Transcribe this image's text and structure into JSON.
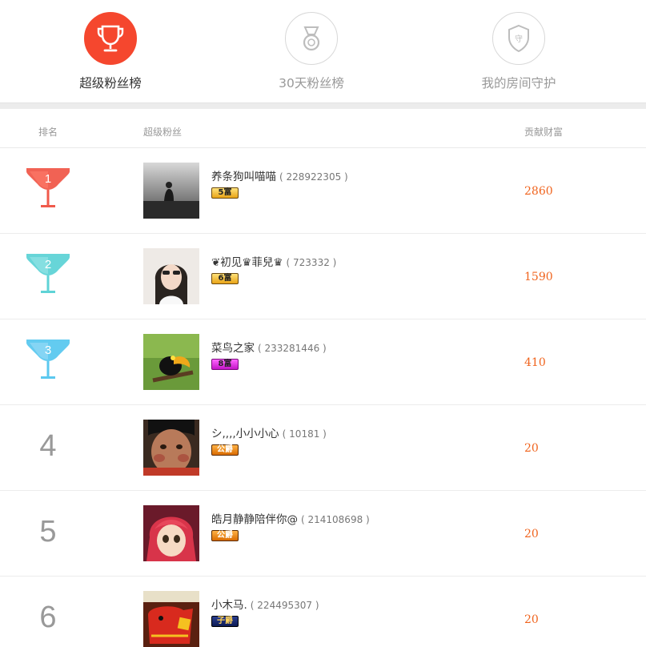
{
  "tabs": [
    {
      "label": "超级粉丝榜",
      "icon": "trophy-icon",
      "active": true
    },
    {
      "label": "30天粉丝榜",
      "icon": "medal-icon",
      "active": false
    },
    {
      "label": "我的房间守护",
      "icon": "shield-icon",
      "active": false
    }
  ],
  "shield_char": "守",
  "table": {
    "headers": {
      "rank": "排名",
      "fan": "超级粉丝",
      "wealth": "贡献财富"
    },
    "rows": [
      {
        "rank": "1",
        "name": "养条狗叫喵喵",
        "uid": "( 228922305 )",
        "badge": "5富",
        "wealth": "2860"
      },
      {
        "rank": "2",
        "name": "❦初见♛菲兒♛",
        "uid": "( 723332 )",
        "badge": "6富",
        "wealth": "1590"
      },
      {
        "rank": "3",
        "name": "菜鸟之家",
        "uid": "( 233281446 )",
        "badge": "8富",
        "wealth": "410"
      },
      {
        "rank": "4",
        "name": "シ,,,,小小小心",
        "uid": "( 10181 )",
        "badge": "公爵",
        "wealth": "20"
      },
      {
        "rank": "5",
        "name": "皓月静静陪伴你@",
        "uid": "( 214108698 )",
        "badge": "公爵",
        "wealth": "20"
      },
      {
        "rank": "6",
        "name": "小木马.",
        "uid": "( 224495307 )",
        "badge": "子爵",
        "wealth": "20"
      }
    ]
  },
  "colors": {
    "accent": "#f5472e",
    "rank1": "#f05a4b",
    "rank2": "#5fd3d6",
    "rank3": "#5bc8ef",
    "wealth": "#f0641e"
  }
}
